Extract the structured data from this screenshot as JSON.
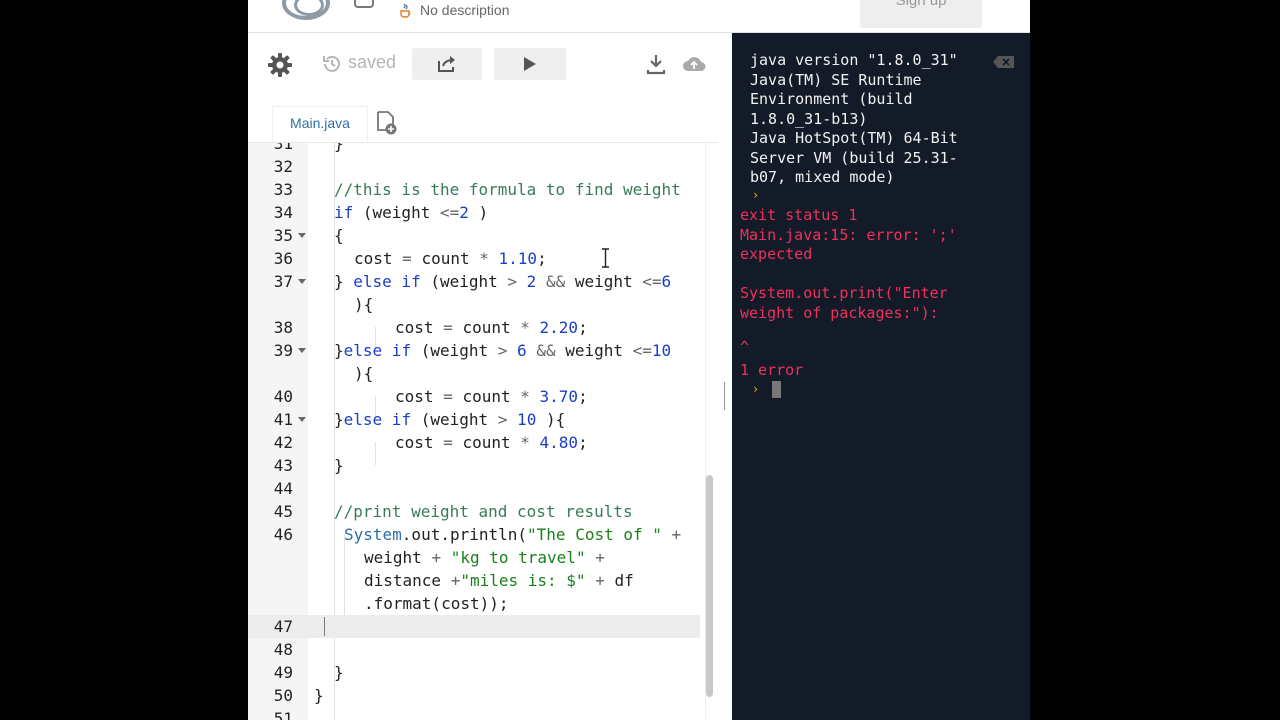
{
  "header": {
    "description": "No description",
    "signup_label": "Sign up"
  },
  "toolbar": {
    "saved_label": "saved"
  },
  "tabs": [
    {
      "label": "Main.java"
    }
  ],
  "editor": {
    "lines": [
      {
        "n": "31",
        "indent": 1
      },
      {
        "n": "32",
        "indent": 0
      },
      {
        "n": "33",
        "indent": 0
      },
      {
        "n": "34",
        "indent": 0
      },
      {
        "n": "35",
        "indent": 0
      },
      {
        "n": "36",
        "indent": 0
      },
      {
        "n": "37",
        "indent": 0
      },
      {
        "n": "",
        "indent": 0
      },
      {
        "n": "38",
        "indent": 0
      },
      {
        "n": "39",
        "indent": 0
      },
      {
        "n": "",
        "indent": 0
      },
      {
        "n": "40",
        "indent": 0
      },
      {
        "n": "41",
        "indent": 0
      },
      {
        "n": "42",
        "indent": 0
      },
      {
        "n": "43",
        "indent": 0
      },
      {
        "n": "44",
        "indent": 0
      },
      {
        "n": "45",
        "indent": 0
      },
      {
        "n": "46",
        "indent": 0
      },
      {
        "n": "",
        "indent": 0
      },
      {
        "n": "",
        "indent": 0
      },
      {
        "n": "",
        "indent": 0
      },
      {
        "n": "47",
        "indent": 0
      },
      {
        "n": "48",
        "indent": 0
      },
      {
        "n": "49",
        "indent": 0
      },
      {
        "n": "50",
        "indent": 0
      },
      {
        "n": "51",
        "indent": 0
      }
    ],
    "code": {
      "l31": "}",
      "l33": "//this is the formula to find weight",
      "l34_kw": "if",
      "l34_a": " (weight ",
      "l34_op": "<=",
      "l34_n": "2",
      "l34_b": " )",
      "l35": "{",
      "l36_a": "cost ",
      "l36_op1": "=",
      "l36_b": " count ",
      "l36_op2": "*",
      "l36_n": " 1.10",
      "l36_c": ";",
      "l37_a": "} ",
      "l37_kw1": "else if",
      "l37_b": " (weight ",
      "l37_op1": ">",
      "l37_n1": " 2",
      "l37_op2": " &&",
      "l37_c": " weight ",
      "l37_op3": "<=",
      "l37_n2": "6",
      "l37w": "){",
      "l38_a": "cost ",
      "l38_op1": "=",
      "l38_b": " count ",
      "l38_op2": "*",
      "l38_n": " 2.20",
      "l38_c": ";",
      "l39_a": "}",
      "l39_kw": "else if",
      "l39_b": " (weight ",
      "l39_op1": ">",
      "l39_n1": " 6",
      "l39_op2": " &&",
      "l39_c": " weight ",
      "l39_op3": "<=",
      "l39_n2": "10",
      "l39w": "){",
      "l40_a": "cost ",
      "l40_op1": "=",
      "l40_b": " count ",
      "l40_op2": "*",
      "l40_n": " 3.70",
      "l40_c": ";",
      "l41_a": "}",
      "l41_kw": "else if",
      "l41_b": " (weight ",
      "l41_op": ">",
      "l41_n": " 10",
      "l41_c": " ){",
      "l42_a": "cost ",
      "l42_op1": "=",
      "l42_b": " count ",
      "l42_op2": "*",
      "l42_n": " 4.80",
      "l42_c": ";",
      "l43": "}",
      "l45": "//print weight and cost results",
      "l46_ty": "System",
      "l46_a": ".out.println(",
      "l46_st": "\"The Cost of \"",
      "l46_op": " +",
      "l46w1_a": "weight ",
      "l46w1_op": "+",
      "l46w1_st": " \"kg to travel\"",
      "l46w1_op2": " +",
      "l46w2_a": "distance ",
      "l46w2_op": "+",
      "l46w2_st": "\"miles is: $\"",
      "l46w2_op2": " +",
      "l46w2_b": " df",
      "l46w3": ".format(cost));",
      "l49": "}",
      "l50": "}"
    }
  },
  "console": {
    "java_version": "java version \"1.8.0_31\"",
    "runtime_1": "Java(TM) SE Runtime",
    "runtime_2": "Environment (build",
    "runtime_3": "1.8.0_31-b13)",
    "vm_1": "Java HotSpot(TM) 64-Bit",
    "vm_2": "Server VM (build 25.31-",
    "vm_3": "b07, mixed mode)",
    "exit_status": "exit status 1",
    "error_1": "Main.java:15: error: ';'",
    "error_2": "expected",
    "source_1": "System.out.print(\"Enter",
    "source_2": "weight of packages:\"):",
    "marker": "^",
    "error_count": "1 error"
  },
  "colors": {
    "console_bg": "#131a28",
    "error_red": "#f0315a",
    "prompt_orange": "#f6a623",
    "tab_blue": "#2f6fa7"
  }
}
